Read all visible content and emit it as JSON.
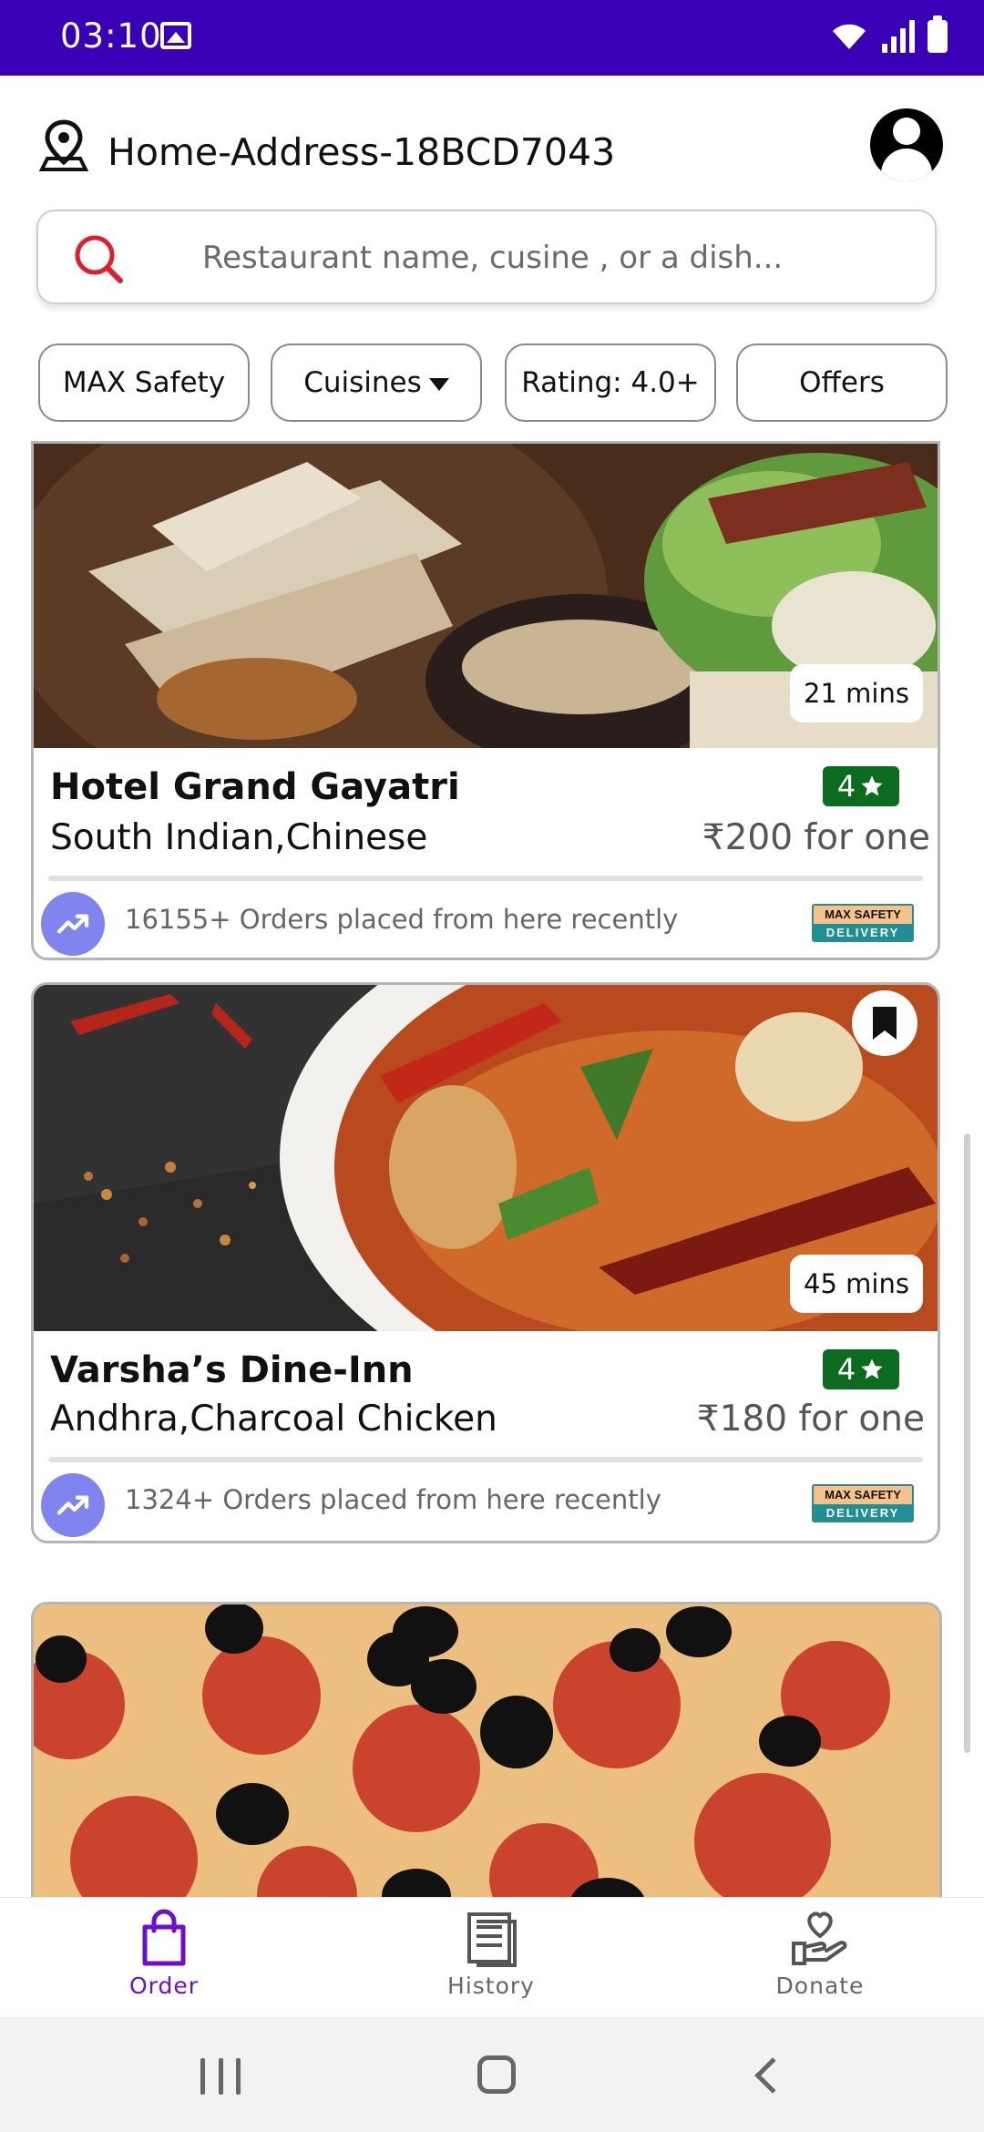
{
  "status_bar": {
    "time": "03:10"
  },
  "header": {
    "address": "Home-Address-18BCD7043"
  },
  "search": {
    "placeholder": "Restaurant name, cusine , or a dish..."
  },
  "filters": [
    {
      "label": "MAX Safety"
    },
    {
      "label": "Cuisines"
    },
    {
      "label": "Rating: 4.0+"
    },
    {
      "label": "Offers"
    }
  ],
  "restaurants": [
    {
      "name": "Hotel Grand Gayatri",
      "cuisine": "South Indian,Chinese",
      "rating": "4",
      "price": "₹200 for one",
      "delivery_time": "21 mins",
      "orders": "16155+ Orders placed from here recently",
      "badge_top": "MAX SAFETY",
      "badge_bottom": "DELIVERY"
    },
    {
      "name": "Varsha’s Dine-Inn",
      "cuisine": "Andhra,Charcoal Chicken",
      "rating": "4",
      "price": "₹180 for one",
      "delivery_time": "45 mins",
      "orders": "1324+ Orders placed from here recently",
      "badge_top": "MAX SAFETY",
      "badge_bottom": "DELIVERY"
    }
  ],
  "bottom_nav": [
    {
      "label": "Order",
      "icon": "shopping-bag-icon",
      "active": true
    },
    {
      "label": "History",
      "icon": "receipt-icon",
      "active": false
    },
    {
      "label": "Donate",
      "icon": "donate-hand-heart-icon",
      "active": false
    }
  ],
  "colors": {
    "status_bar": "#3a00b5",
    "accent": "#6a11c9",
    "rating_badge": "#0b6b1e",
    "search_icon": "#e01e2b",
    "trend_circle": "#8084ee"
  }
}
